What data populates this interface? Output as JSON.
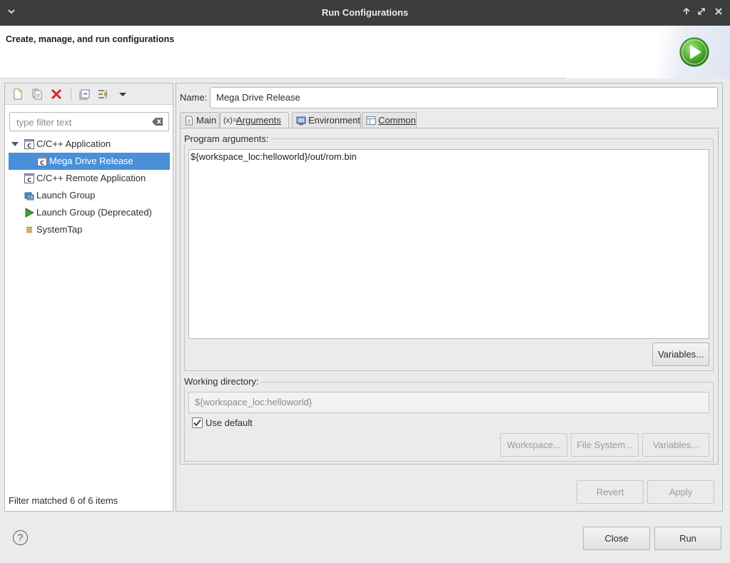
{
  "window": {
    "title": "Run Configurations"
  },
  "header": {
    "description": "Create, manage, and run configurations"
  },
  "left": {
    "filter_placeholder": "type filter text",
    "tree": [
      {
        "label": "C/C++ Application",
        "expanded": true
      },
      {
        "label": "Mega Drive Release",
        "selected": true
      },
      {
        "label": "C/C++ Remote Application"
      },
      {
        "label": "Launch Group"
      },
      {
        "label": "Launch Group (Deprecated)"
      },
      {
        "label": "SystemTap"
      }
    ],
    "status": "Filter matched 6 of 6 items"
  },
  "right": {
    "name_label": "Name:",
    "name_value": "Mega Drive Release",
    "tabs": [
      {
        "label": "Main"
      },
      {
        "label": "Arguments",
        "active": true
      },
      {
        "label": "Environment"
      },
      {
        "label": "Common"
      }
    ],
    "program_args_label": "Program arguments:",
    "program_args_value": "${workspace_loc:helloworld}/out/rom.bin",
    "variables_label": "Variables...",
    "working_dir_label": "Working directory:",
    "working_dir_value": "${workspace_loc:helloworld}",
    "use_default_label": "Use default",
    "use_default_checked": true,
    "workspace_btn": "Workspace...",
    "filesystem_btn": "File System...",
    "variables2_btn": "Variables...",
    "revert_btn": "Revert",
    "apply_btn": "Apply"
  },
  "footer": {
    "close_btn": "Close",
    "run_btn": "Run"
  }
}
